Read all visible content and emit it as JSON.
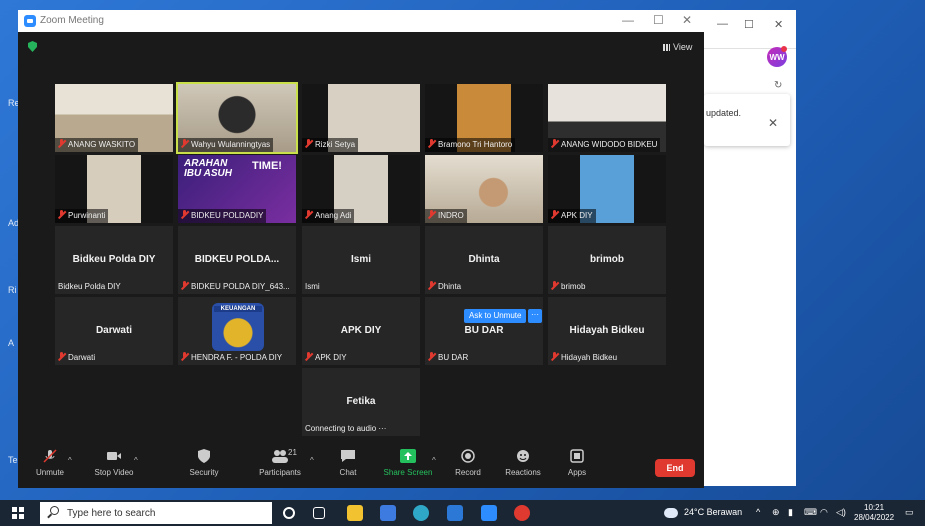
{
  "zoom": {
    "title": "Zoom Meeting",
    "view_label": "View",
    "participants": [
      {
        "name": "ANANG WASKITO",
        "type": "video",
        "muted": true
      },
      {
        "name": "Wahyu Wulanningtyas",
        "type": "video",
        "muted": true,
        "active": true
      },
      {
        "name": "Rizki Setya",
        "type": "video",
        "muted": true
      },
      {
        "name": "Bramono Tri Hantoro",
        "type": "video",
        "muted": true
      },
      {
        "name": "ANANG WIDODO BIDKEU",
        "type": "video",
        "muted": true
      },
      {
        "name": "Purwinanti",
        "type": "video",
        "muted": true
      },
      {
        "name": "BIDKEU POLDADIY",
        "type": "video",
        "muted": true,
        "banner_line1": "ARAHAN",
        "banner_line2": "IBU ASUH",
        "banner_time": "TIME!"
      },
      {
        "name": "Anang Adi",
        "type": "video",
        "muted": true
      },
      {
        "name": "INDRO",
        "type": "video",
        "muted": true
      },
      {
        "name": "APK DIY",
        "type": "video",
        "muted": true
      },
      {
        "name": "Bidkeu Polda DIY",
        "display": "Bidkeu Polda DIY",
        "type": "name",
        "muted": false
      },
      {
        "name": "BIDKEU POLDA DIY_643...",
        "display": "BIDKEU POLDA...",
        "type": "name",
        "muted": true
      },
      {
        "name": "Ismi",
        "display": "Ismi",
        "type": "name",
        "muted": false
      },
      {
        "name": "Dhinta",
        "display": "Dhinta",
        "type": "name",
        "muted": true
      },
      {
        "name": "brimob",
        "display": "brimob",
        "type": "name",
        "muted": true
      },
      {
        "name": "Darwati",
        "display": "Darwati",
        "type": "name",
        "muted": true
      },
      {
        "name": "HENDRA F. - POLDA DIY",
        "type": "logo",
        "muted": true,
        "logo_text": "KEUANGAN"
      },
      {
        "name": "APK DIY",
        "display": "APK DIY",
        "type": "name",
        "muted": true
      },
      {
        "name": "BU DAR",
        "display": "BU DAR",
        "type": "name",
        "muted": true
      },
      {
        "name": "Hidayah Bidkeu",
        "display": "Hidayah Bidkeu",
        "type": "name",
        "muted": true
      },
      {
        "name": "Connecting to audio ···",
        "display": "Fetika",
        "type": "name",
        "muted": false
      }
    ],
    "ask_unmute_label": "Ask to Unmute",
    "more_label": "···",
    "toolbar": {
      "unmute": "Unmute",
      "stop_video": "Stop Video",
      "security": "Security",
      "participants": "Participants",
      "participants_count": "21",
      "chat": "Chat",
      "share_screen": "Share Screen",
      "record": "Record",
      "reactions": "Reactions",
      "apps": "Apps",
      "end": "End"
    }
  },
  "browser": {
    "notification_text": "updated.",
    "badge": "WW"
  },
  "taskbar": {
    "search_placeholder": "Type here to search",
    "weather": "24°C Berawan",
    "time": "10:21",
    "date": "28/04/2022"
  },
  "colors": {
    "zoom_blue": "#2d8cff",
    "end_red": "#e0392f",
    "active_speaker": "#c9e04a",
    "share_green": "#25c05e"
  }
}
